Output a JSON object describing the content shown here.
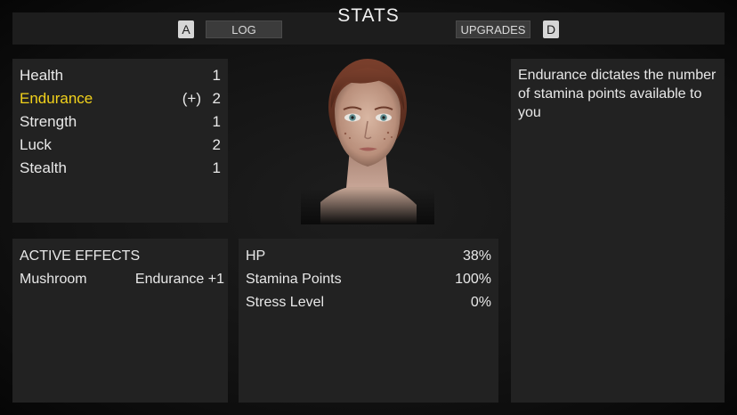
{
  "header": {
    "left_key": "A",
    "log_label": "LOG",
    "title": "STATS",
    "upgrades_label": "UPGRADES",
    "right_key": "D"
  },
  "stats": [
    {
      "name": "Health",
      "value": "1",
      "plus": ""
    },
    {
      "name": "Endurance",
      "value": "2",
      "plus": "(+)"
    },
    {
      "name": "Strength",
      "value": "1",
      "plus": ""
    },
    {
      "name": "Luck",
      "value": "2",
      "plus": ""
    },
    {
      "name": "Stealth",
      "value": "1",
      "plus": ""
    }
  ],
  "selected_stat_color": "#f2d21b",
  "description": "Endurance dictates the number of stamina points available to you",
  "effects": {
    "title": "ACTIVE EFFECTS",
    "items": [
      {
        "name": "Mushroom",
        "effect": "Endurance +1"
      }
    ]
  },
  "vitals": [
    {
      "name": "HP",
      "value": "38%"
    },
    {
      "name": "Stamina Points",
      "value": "100%"
    },
    {
      "name": "Stress Level",
      "value": "0%"
    }
  ]
}
